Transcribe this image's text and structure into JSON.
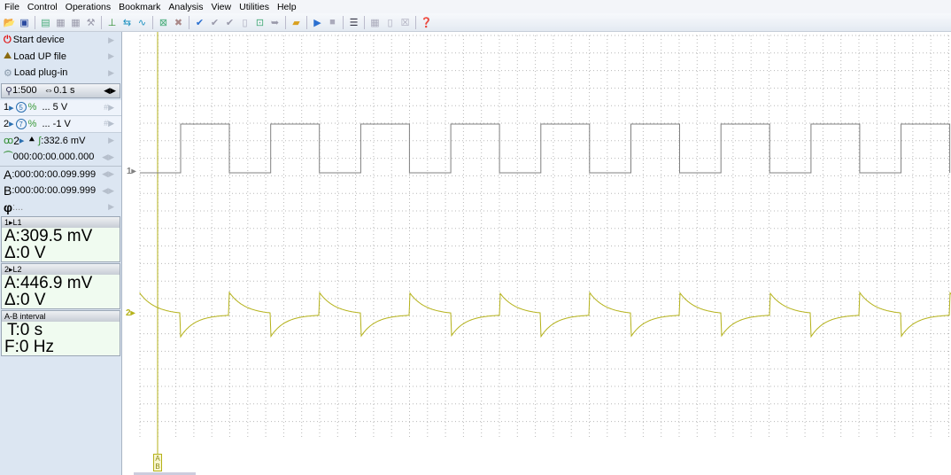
{
  "menu": [
    "File",
    "Control",
    "Operations",
    "Bookmark",
    "Analysis",
    "View",
    "Utilities",
    "Help"
  ],
  "toolbar_icons": [
    "open-icon",
    "save-icon",
    "print-icon",
    "copy-icon",
    "paste-icon",
    "tool-icon",
    "cursor-icon",
    "channel-icon",
    "filter-icon",
    "zoom-icon",
    "clear-icon",
    "check-icon",
    "check-down-icon",
    "check-down2-icon",
    "page-icon",
    "select-icon",
    "export-icon",
    "bookmark-icon",
    "play-icon",
    "stop-icon",
    "display-icon",
    "grid-icon",
    "doc-icon",
    "close-icon",
    "help-icon"
  ],
  "sidebar": {
    "start": "Start device",
    "load_up": "Load UP file",
    "load_plugin": "Load plug-in",
    "scale": "1:500",
    "time": "0.1 s",
    "ch1": {
      "num": "1",
      "probe": "5",
      "range": "... 5 V"
    },
    "ch2": {
      "num": "2",
      "probe": "7",
      "range": "... -1 V"
    },
    "trigger": {
      "ch": "2",
      "level": ":332.6 mV"
    },
    "trig_time": "000:00:00.000.000",
    "a": {
      "label": "A",
      "value": ":000:00:00.099.999"
    },
    "b": {
      "label": "B",
      "value": ":000:00:00.099.999"
    },
    "phi": {
      "label": "φ",
      "value": ":..."
    },
    "l1": {
      "title": "1▸L1",
      "a": "A:309.5 mV",
      "d": "Δ:0 V"
    },
    "l2": {
      "title": "2▸L2",
      "a": "A:446.9 mV",
      "d": "Δ:0 V"
    },
    "ab": {
      "title": "A-B interval",
      "t": "T:0 s",
      "f": "F:0 Hz"
    }
  },
  "scope": {
    "ch1_label": "1▸",
    "ch2_label": "2▸",
    "marker_a": "A",
    "marker_b": "B",
    "ch1_color": "#808080",
    "ch2_color": "#b5b21a"
  }
}
